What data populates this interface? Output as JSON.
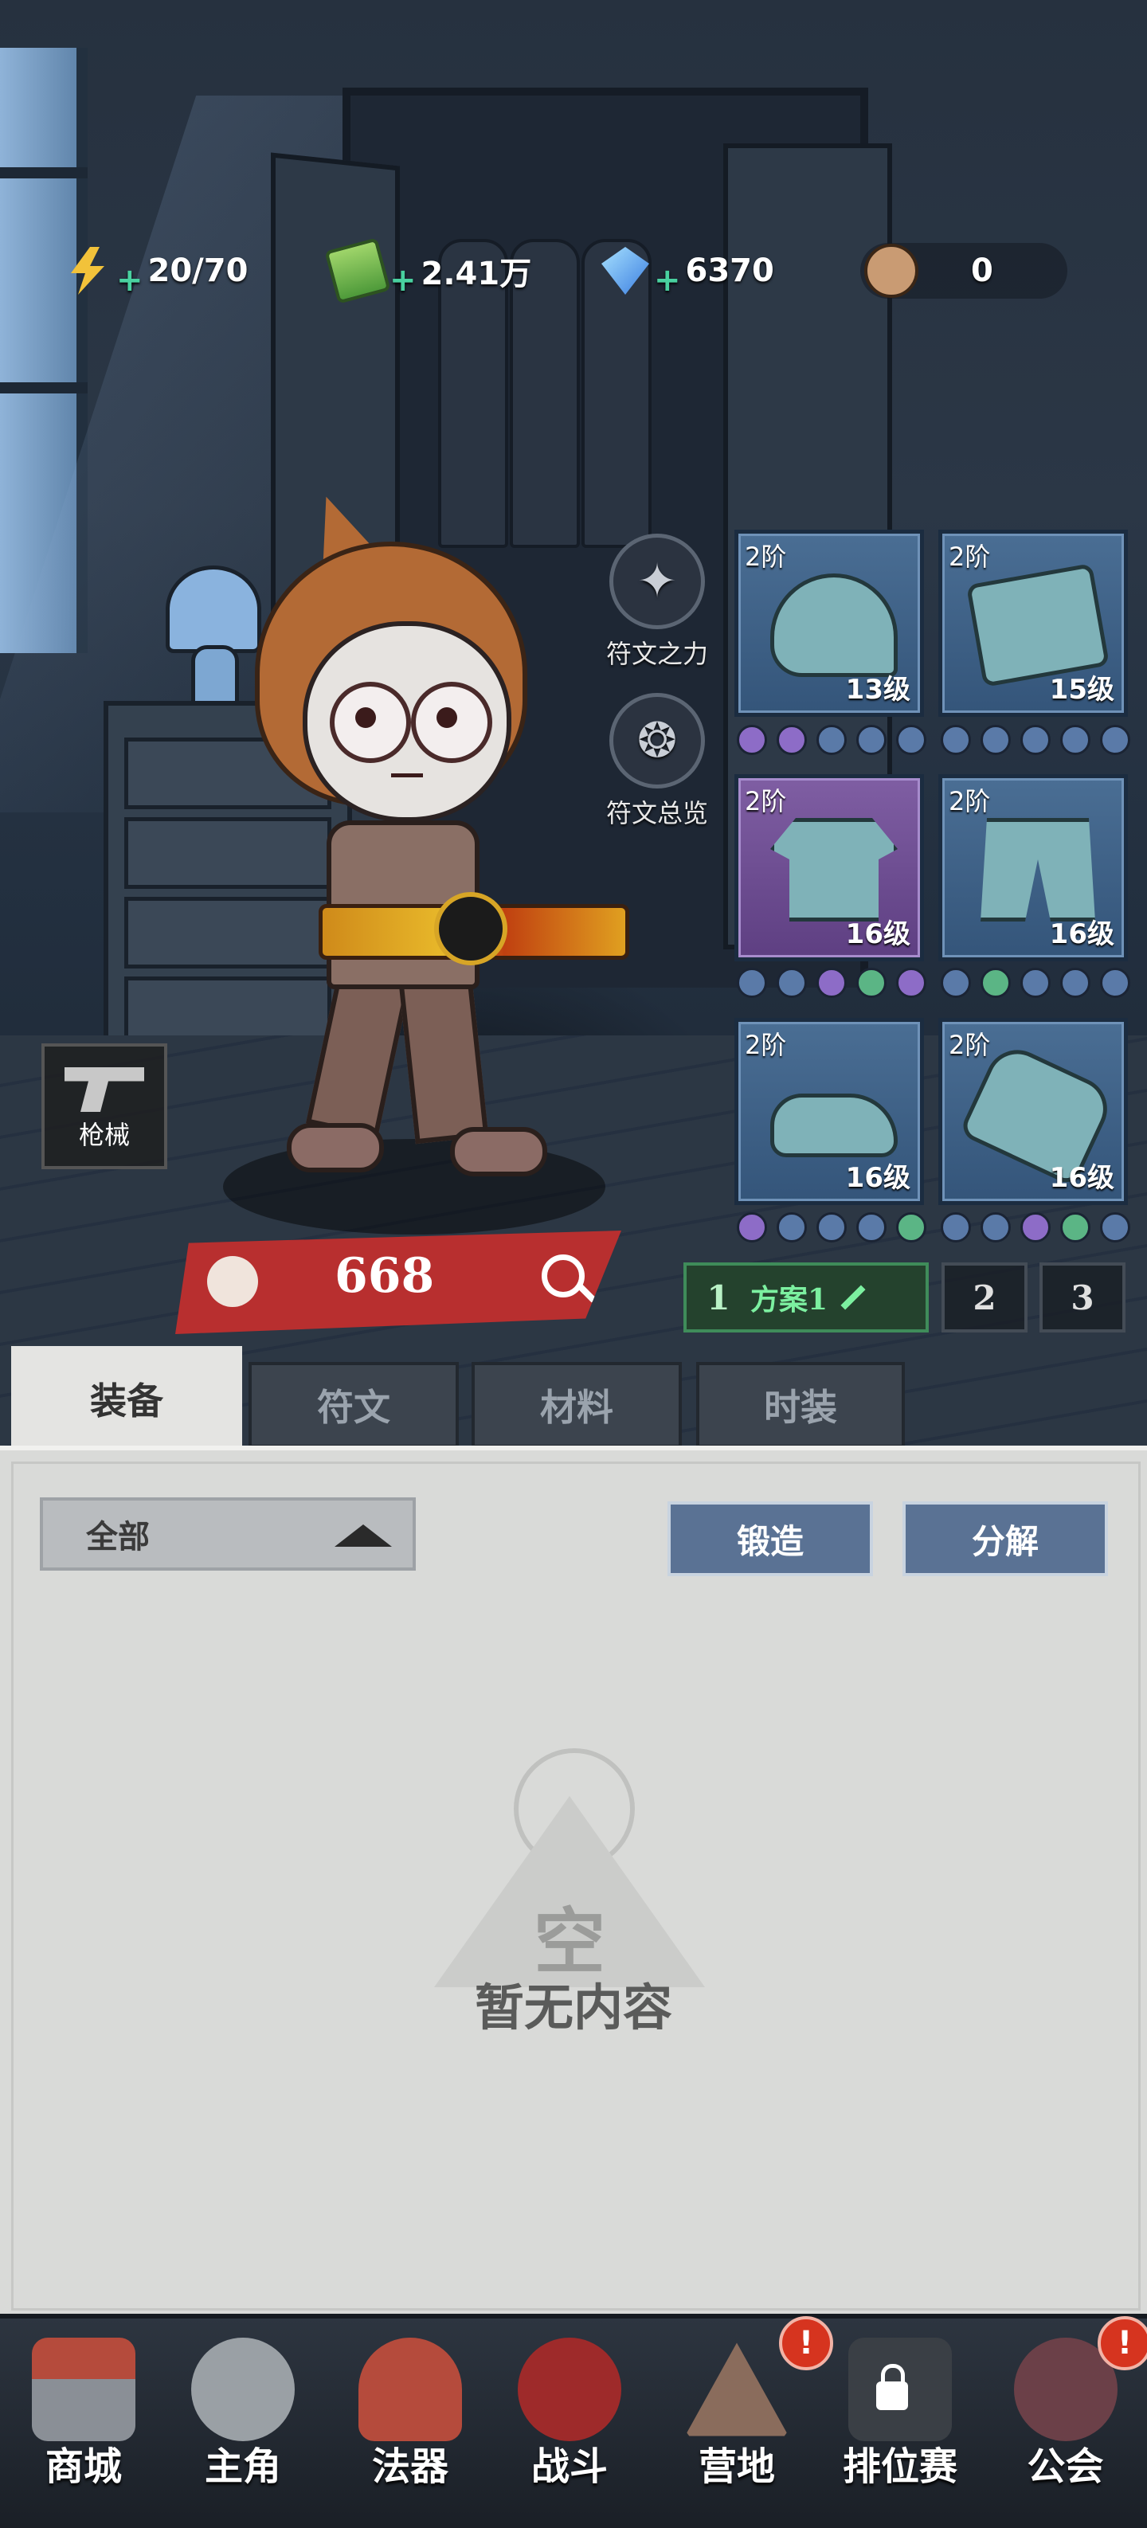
{
  "resources": {
    "energy": {
      "icon": "energy-bolt-icon",
      "value": "20/70"
    },
    "cash": {
      "icon": "cash-stack-icon",
      "value": "2.41万"
    },
    "gems": {
      "icon": "diamond-icon",
      "value": "6370"
    },
    "avatar_currency": {
      "icon": "character-face-icon",
      "value": "0"
    }
  },
  "rune_buttons": [
    {
      "label": "符文之力",
      "icon": "rune-power-icon"
    },
    {
      "label": "符文总览",
      "icon": "rune-overview-icon"
    }
  ],
  "equipment": [
    {
      "slot": "hat",
      "tier": "2阶",
      "level": "13级",
      "rarity": "blue",
      "gems": [
        "p",
        "p",
        "b",
        "b",
        "b"
      ]
    },
    {
      "slot": "armor",
      "tier": "2阶",
      "level": "15级",
      "rarity": "blue",
      "gems": [
        "b",
        "b",
        "b",
        "b",
        "b"
      ]
    },
    {
      "slot": "shirt",
      "tier": "2阶",
      "level": "16级",
      "rarity": "purple",
      "gems": [
        "b",
        "b",
        "p",
        "g",
        "p"
      ]
    },
    {
      "slot": "pants",
      "tier": "2阶",
      "level": "16级",
      "rarity": "blue",
      "gems": [
        "b",
        "g",
        "b",
        "b",
        "b"
      ]
    },
    {
      "slot": "shoes",
      "tier": "2阶",
      "level": "16级",
      "rarity": "blue",
      "gems": [
        "p",
        "b",
        "b",
        "b",
        "g"
      ]
    },
    {
      "slot": "gloves",
      "tier": "2阶",
      "level": "16级",
      "rarity": "blue",
      "gems": [
        "b",
        "b",
        "p",
        "g",
        "b"
      ]
    }
  ],
  "weapon_tag": {
    "label": "枪械",
    "icon": "revolver-icon"
  },
  "power": {
    "value": "668",
    "icon": "fist-icon",
    "search_icon": "magnifier-icon"
  },
  "loadouts": [
    {
      "number": "1",
      "name": "方案1",
      "active": true
    },
    {
      "number": "2",
      "active": false
    },
    {
      "number": "3",
      "active": false
    }
  ],
  "tabs": [
    "装备",
    "符文",
    "材料",
    "时装"
  ],
  "active_tab": "装备",
  "filter": {
    "selected": "全部"
  },
  "actions": {
    "forge": "锻造",
    "dismantle": "分解"
  },
  "empty_state": {
    "icon_char": "空",
    "message": "暂无内容"
  },
  "nav": [
    {
      "label": "商城",
      "icon": "shop-icon",
      "alert": false
    },
    {
      "label": "主角",
      "icon": "hero-icon",
      "alert": false,
      "active": true
    },
    {
      "label": "法器",
      "icon": "magic-tool-icon",
      "alert": false
    },
    {
      "label": "战斗",
      "icon": "battle-icon",
      "alert": false
    },
    {
      "label": "营地",
      "icon": "camp-icon",
      "alert": true
    },
    {
      "label": "排位赛",
      "icon": "ranked-icon",
      "alert": false,
      "locked": true
    },
    {
      "label": "公会",
      "icon": "guild-icon",
      "alert": true
    }
  ],
  "alert_glyph": "!",
  "colors": {
    "power_banner": "#b82f2f",
    "active_loadout": "#7cf0a0",
    "action_button": "#5a7294",
    "panel_bg": "#d9dad8"
  }
}
